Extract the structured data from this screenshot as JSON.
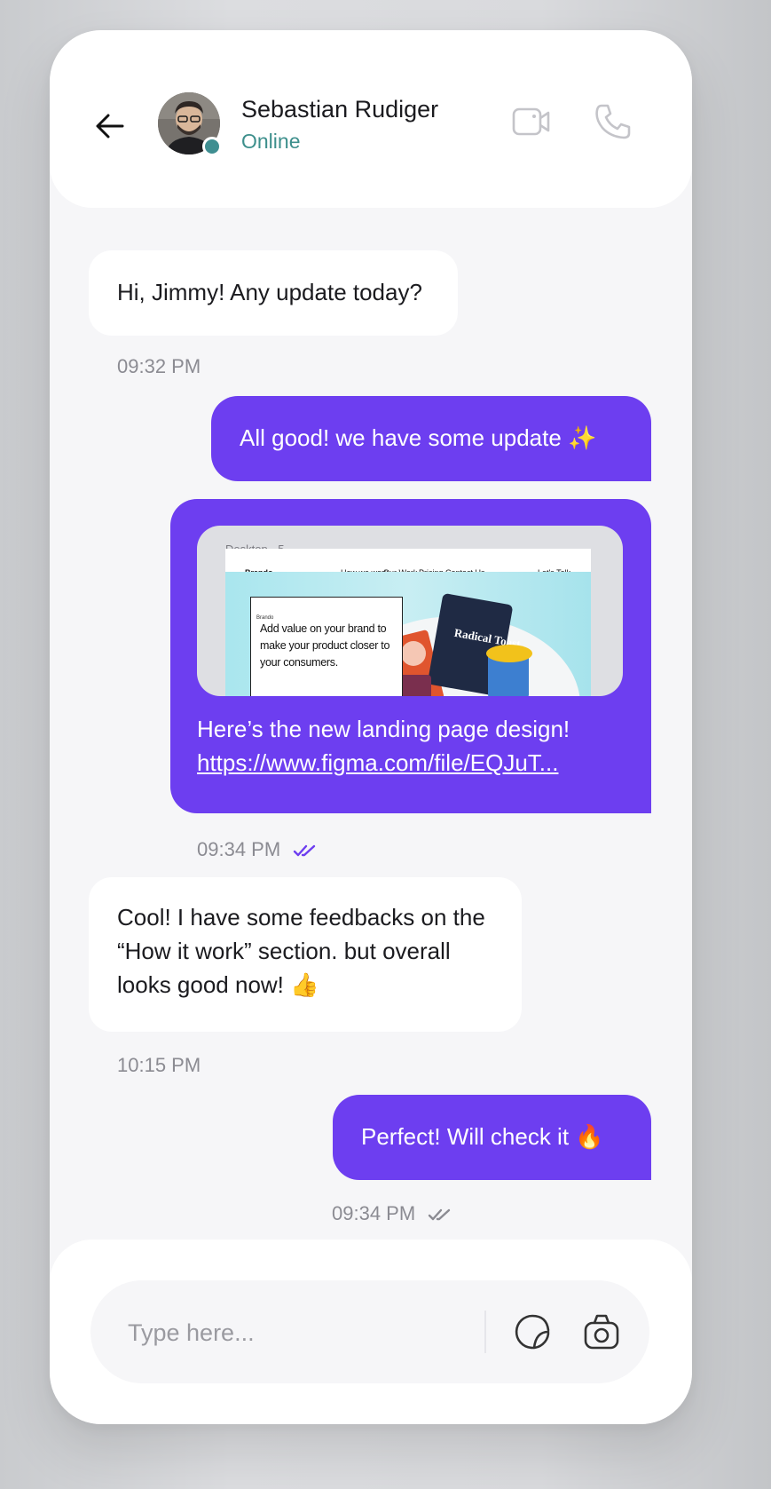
{
  "contact": {
    "name": "Sebastian Rudiger",
    "status": "Online"
  },
  "messages": [
    {
      "direction": "incoming",
      "text": "Hi, Jimmy! Any update today?",
      "time": "09:32 PM"
    },
    {
      "direction": "outgoing",
      "text": "All good! we have some update ✨"
    },
    {
      "direction": "outgoing",
      "preview": {
        "frame_label": "Desktop - 5",
        "nav_brand": "Brando",
        "nav_links": [
          "How we work",
          "Our Work",
          "Pricing",
          "Contact Us"
        ],
        "nav_cta": "Let's Talk →",
        "card_brand": "Brando",
        "headline": "Add value on your brand to make your product closer to your consumers.",
        "product_text": "Radical Toast"
      },
      "text": "Here’s the new landing page design!",
      "link": "https://www.figma.com/file/EQJuT...",
      "time": "09:34 PM",
      "read": true
    },
    {
      "direction": "incoming",
      "text": "Cool! I have some feedbacks on the “How it work” section. but overall looks good now! 👍",
      "time": "10:15 PM"
    },
    {
      "direction": "outgoing",
      "text": "Perfect! Will check it 🔥",
      "time": "09:34 PM",
      "read": false
    }
  ],
  "composer": {
    "placeholder": "Type here..."
  },
  "icons": [
    "back-arrow-icon",
    "video-camera-icon",
    "phone-icon",
    "double-check-icon",
    "sticker-icon",
    "camera-icon"
  ],
  "colors": {
    "accent": "#6d3ef0",
    "online": "#3d8f8c",
    "background": "#f6f6f8"
  }
}
